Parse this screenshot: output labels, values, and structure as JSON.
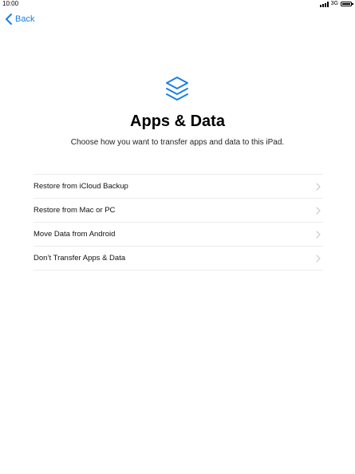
{
  "status_bar": {
    "time": "10:00",
    "network": "3G",
    "icons": [
      "signal-icon",
      "battery-icon"
    ]
  },
  "nav": {
    "back_label": "Back",
    "back_icon": "chevron-left-icon"
  },
  "header": {
    "icon": "layers-stack-icon",
    "title": "Apps & Data",
    "subtitle": "Choose how you want to transfer apps and data to this iPad."
  },
  "options": [
    {
      "label": "Restore from iCloud Backup"
    },
    {
      "label": "Restore from Mac or PC"
    },
    {
      "label": "Move Data from Android"
    },
    {
      "label": "Don’t Transfer Apps & Data"
    }
  ],
  "colors": {
    "accent": "#1a7fe3",
    "divider": "#ececec",
    "chevron": "#c7c7cc"
  }
}
